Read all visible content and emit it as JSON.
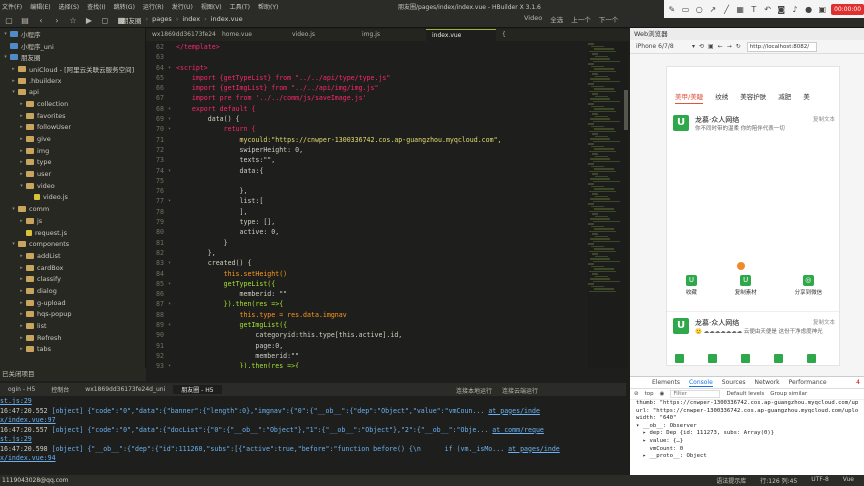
{
  "window": {
    "title": "朋友圈/pages/index/index.vue - HBuilder X 3.1.6",
    "menus": [
      "文件(F)",
      "编辑(E)",
      "选择(S)",
      "查找(I)",
      "跳转(G)",
      "运行(R)",
      "发行(U)",
      "视图(V)",
      "工具(T)",
      "帮助(Y)"
    ]
  },
  "breadcrumb": [
    "朋友圈",
    "pages",
    "index",
    "index.vue"
  ],
  "toolbar_right": [
    "Video",
    "全选",
    "上一个",
    "下一个"
  ],
  "annot": {
    "time": "00:00:00"
  },
  "editor_tabs": [
    {
      "label": "wx1869dd36173fe24d_uni",
      "active": false
    },
    {
      "label": "home.vue",
      "active": false
    },
    {
      "label": "video.js",
      "active": false
    },
    {
      "label": "img.js",
      "active": false
    },
    {
      "label": "index.vue",
      "active": true
    },
    {
      "label": "{",
      "active": false
    }
  ],
  "sidebar": {
    "items": [
      {
        "label": "小程序",
        "depth": 0,
        "arrow": "▾",
        "icon": "hx"
      },
      {
        "label": "小程序_uni",
        "depth": 0,
        "arrow": "",
        "icon": "hx"
      },
      {
        "label": "朋友圈",
        "depth": 0,
        "arrow": "▾",
        "icon": "hx"
      },
      {
        "label": "uniCloud - [阿里云关联云服务空间]",
        "depth": 1,
        "arrow": "▸",
        "icon": "folder"
      },
      {
        "label": ".hbuilderx",
        "depth": 1,
        "arrow": "▸",
        "icon": "folder"
      },
      {
        "label": "api",
        "depth": 1,
        "arrow": "▾",
        "icon": "folder"
      },
      {
        "label": "collection",
        "depth": 2,
        "arrow": "▸",
        "icon": "folder"
      },
      {
        "label": "favorites",
        "depth": 2,
        "arrow": "▸",
        "icon": "folder"
      },
      {
        "label": "followUser",
        "depth": 2,
        "arrow": "▸",
        "icon": "folder"
      },
      {
        "label": "give",
        "depth": 2,
        "arrow": "▸",
        "icon": "folder"
      },
      {
        "label": "img",
        "depth": 2,
        "arrow": "▸",
        "icon": "folder"
      },
      {
        "label": "type",
        "depth": 2,
        "arrow": "▸",
        "icon": "folder"
      },
      {
        "label": "user",
        "depth": 2,
        "arrow": "▸",
        "icon": "folder"
      },
      {
        "label": "video",
        "depth": 2,
        "arrow": "▾",
        "icon": "folder"
      },
      {
        "label": "video.js",
        "depth": 3,
        "arrow": "",
        "icon": "file"
      },
      {
        "label": "comm",
        "depth": 1,
        "arrow": "▾",
        "icon": "folder"
      },
      {
        "label": "js",
        "depth": 2,
        "arrow": "▸",
        "icon": "folder"
      },
      {
        "label": "request.js",
        "depth": 2,
        "arrow": "",
        "icon": "file"
      },
      {
        "label": "components",
        "depth": 1,
        "arrow": "▾",
        "icon": "folder"
      },
      {
        "label": "addList",
        "depth": 2,
        "arrow": "▸",
        "icon": "folder"
      },
      {
        "label": "cardBox",
        "depth": 2,
        "arrow": "▸",
        "icon": "folder"
      },
      {
        "label": "classify",
        "depth": 2,
        "arrow": "▸",
        "icon": "folder"
      },
      {
        "label": "dialog",
        "depth": 2,
        "arrow": "▸",
        "icon": "folder"
      },
      {
        "label": "g-upload",
        "depth": 2,
        "arrow": "▸",
        "icon": "folder"
      },
      {
        "label": "hqs-popup",
        "depth": 2,
        "arrow": "▸",
        "icon": "folder"
      },
      {
        "label": "list",
        "depth": 2,
        "arrow": "▸",
        "icon": "folder"
      },
      {
        "label": "Refresh",
        "depth": 2,
        "arrow": "▸",
        "icon": "folder"
      },
      {
        "label": "tabs",
        "depth": 2,
        "arrow": "▸",
        "icon": "folder"
      }
    ],
    "footer": "已关闭项目"
  },
  "code_lines": [
    {
      "n": "62",
      "f": "",
      "t": "</template>",
      "c": "tag"
    },
    {
      "n": "63",
      "f": "",
      "t": "",
      "c": ""
    },
    {
      "n": "64",
      "f": "▾",
      "t": "<script>",
      "c": "tag"
    },
    {
      "n": "65",
      "f": "",
      "t": "    import {getTypeList} from \"../../api/type/type.js\"",
      "c": "import"
    },
    {
      "n": "66",
      "f": "",
      "t": "    import {getImgList} from \"../../api/img/img.js\"",
      "c": "import"
    },
    {
      "n": "67",
      "f": "",
      "t": "    import pre from '../../comm/js/saveImage.js'",
      "c": "import"
    },
    {
      "n": "68",
      "f": "▾",
      "t": "    export default {",
      "c": "kw"
    },
    {
      "n": "69",
      "f": "▾",
      "t": "        data() {",
      "c": ""
    },
    {
      "n": "70",
      "f": "▾",
      "t": "            return {",
      "c": "kw"
    },
    {
      "n": "71",
      "f": "",
      "t": "                mycould:\"https://cnwper-1300336742.cos.ap-guangzhou.myqcloud.com\",",
      "c": "str"
    },
    {
      "n": "72",
      "f": "",
      "t": "                swiperHeight: 0,",
      "c": ""
    },
    {
      "n": "73",
      "f": "",
      "t": "                texts:\"\",",
      "c": ""
    },
    {
      "n": "74",
      "f": "▾",
      "t": "                data:{",
      "c": ""
    },
    {
      "n": "75",
      "f": "",
      "t": "",
      "c": ""
    },
    {
      "n": "76",
      "f": "",
      "t": "                },",
      "c": ""
    },
    {
      "n": "77",
      "f": "▾",
      "t": "                list:[",
      "c": ""
    },
    {
      "n": "78",
      "f": "",
      "t": "                ],",
      "c": ""
    },
    {
      "n": "79",
      "f": "",
      "t": "                type: [],",
      "c": ""
    },
    {
      "n": "80",
      "f": "",
      "t": "                active: 0,",
      "c": ""
    },
    {
      "n": "81",
      "f": "",
      "t": "            }",
      "c": ""
    },
    {
      "n": "82",
      "f": "",
      "t": "        },",
      "c": ""
    },
    {
      "n": "83",
      "f": "▾",
      "t": "        created() {",
      "c": ""
    },
    {
      "n": "84",
      "f": "",
      "t": "            this.setHeight()",
      "c": "this"
    },
    {
      "n": "85",
      "f": "▾",
      "t": "            getTypeList({",
      "c": "fn"
    },
    {
      "n": "86",
      "f": "",
      "t": "                memberid: \"\"",
      "c": ""
    },
    {
      "n": "87",
      "f": "▾",
      "t": "            }).then(res =>{",
      "c": "fn"
    },
    {
      "n": "88",
      "f": "",
      "t": "                this.type = res.data.imgnav",
      "c": "this"
    },
    {
      "n": "89",
      "f": "▾",
      "t": "                getImgList({",
      "c": "fn"
    },
    {
      "n": "90",
      "f": "",
      "t": "                    categoryid:this.type[this.active].id,",
      "c": ""
    },
    {
      "n": "91",
      "f": "",
      "t": "                    page:0,",
      "c": ""
    },
    {
      "n": "92",
      "f": "",
      "t": "                    memberid:\"\"",
      "c": ""
    },
    {
      "n": "93",
      "f": "▾",
      "t": "                }).then(res =>{",
      "c": "fn"
    },
    {
      "n": "94",
      "f": "",
      "t": "                    ...",
      "c": ""
    }
  ],
  "bottom_tabs": [
    {
      "label": "ogin - H5",
      "active": false
    },
    {
      "label": "控制台",
      "active": false
    },
    {
      "label": "wx1869dd36173fe24d_uni",
      "active": false
    },
    {
      "label": "朋友圈 - H5",
      "active": true
    }
  ],
  "bottom_status": [
    "连接本地运行",
    "连接云端运行"
  ],
  "console_logs": [
    {
      "time": "",
      "text": "st.js:29",
      "link": ""
    },
    {
      "time": "16:47:20.552",
      "text": " [object] {\"code\":\"0\",\"data\":{\"banner\":{\"length\":0},\"imgnav\":{\"0\":{\"__ob__\":{\"dep\":\"Object\",\"value\":\"vmCoun...",
      "link": "at pages/inde"
    },
    {
      "time": "",
      "text": "x/index.vue:97",
      "link": ""
    },
    {
      "time": "16:47:20.557",
      "text": " [object] {\"code\":\"0\",\"data\":{\"docList\":{\"0\":{\"__ob__\":\"Object\"},\"1\":{\"__ob__\":\"Object\"},\"2\":{\"__ob__\":\"Obje...",
      "link": "at comm/reque"
    },
    {
      "time": "",
      "text": "st.js:29",
      "link": ""
    },
    {
      "time": "16:47:20.598",
      "text": " [object] {\"__ob__\":{\"dep\":{\"id\":111260,\"subs\":[{\"active\":true,\"before\":\"function before() {\\n      if (vm._isMo...",
      "link": "at pages/inde"
    },
    {
      "time": "",
      "text": "x/index.vue:94",
      "link": ""
    }
  ],
  "status_left": "1119043028@qq.com",
  "status_right": [
    "语法提示库",
    "行:126 列:45",
    "UTF-8",
    "Vue"
  ],
  "web": {
    "panel_title": "Web浏览器",
    "device": "iPhone 6/7/8",
    "url": "http://localhost:8082/",
    "tabs": [
      "美甲/美睫",
      "纹绣",
      "美容护肤",
      "减肥",
      "美"
    ],
    "active_tab": 0,
    "card1": {
      "name": "龙慕·众人网络",
      "desc": "你不同时带的温柔 你的陪伴代表一切",
      "copy": "复制文本"
    },
    "actions": [
      "收藏",
      "复制素材",
      "分享到微信"
    ],
    "card2": {
      "name": "龙慕·众人网络",
      "desc": "🙂 ☁☁☁☁☁☁☁ 云便由天便是 这份干净虑度神光",
      "copy": "复制文本"
    }
  },
  "devtools": {
    "tabs": [
      "Elements",
      "Console",
      "Sources",
      "Network",
      "Performance"
    ],
    "active": "Console",
    "context": "top",
    "filter_placeholder": "Filter",
    "levels": "Default levels",
    "group_similar": "Group similar",
    "warn_count": "4",
    "lines": [
      "thumb: \"https://cnwper-1300336742.cos.ap-guangzhou.myqcloud.com/up",
      "url: \"https://cnwper-1300336742.cos.ap-guangzhou.myqcloud.com/uplo",
      "width: \"640\"",
      "▾ __ob__: Observer",
      "  ▸ dep: Dep {id: 111273, subs: Array(0)}",
      "  ▸ value: {…}",
      "    vmCount: 0",
      "  ▸ __proto__: Object"
    ]
  }
}
